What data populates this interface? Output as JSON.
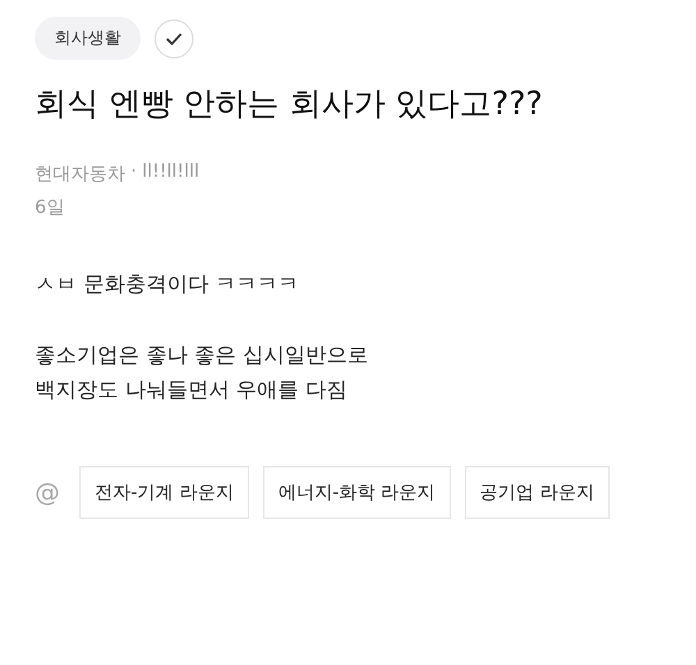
{
  "category": {
    "label": "회사생활"
  },
  "title": "회식 엔빵 안하는 회사가 있다고???",
  "meta": {
    "company": "현대자동차",
    "separator": "·",
    "author": "ll!!ll!lll",
    "time": "6일"
  },
  "body": [
    [
      "ㅅㅂ 문화충격이다 ㅋㅋㅋㅋ"
    ],
    [
      "좋소기업은 좋나 좋은 십시일반으로",
      "백지장도 나눠들면서 우애를 다짐"
    ]
  ],
  "mention_symbol": "@",
  "lounges": [
    "전자-기계 라운지",
    "에너지-화학 라운지",
    "공기업 라운지"
  ]
}
